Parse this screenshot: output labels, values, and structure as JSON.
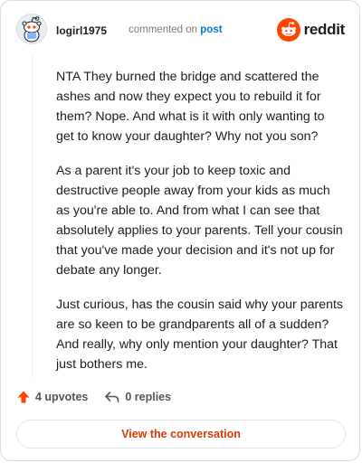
{
  "comment": {
    "username": "logirl1975",
    "commented_on_text": "commented on",
    "post_link_text": "post",
    "paragraphs": [
      "NTA They burned the bridge and scattered the ashes and now they expect you to rebuild it for them? Nope. And what is it with only wanting to get to know your daughter? Why not you son?",
      "As a parent it's your job to keep toxic and destructive people away from your kids as much as you're able to. And from what I can see that absolutely applies to your parents. Tell your cousin that you've made your decision and it's not up for debate any longer.",
      "Just curious, has the cousin said why your parents are so keen to be grandparents all of a sudden? And really, why only mention your daughter? That just bothers me."
    ]
  },
  "brand": {
    "name": "reddit",
    "icon": "reddit-logo-icon",
    "color": "#ff4500"
  },
  "actions": {
    "upvotes_label": "4 upvotes",
    "replies_label": "0 replies",
    "upvote_icon": "upvote-arrow-icon",
    "reply_icon": "reply-arrow-icon"
  },
  "cta": {
    "label": "View the conversation",
    "color": "#d93a00"
  }
}
